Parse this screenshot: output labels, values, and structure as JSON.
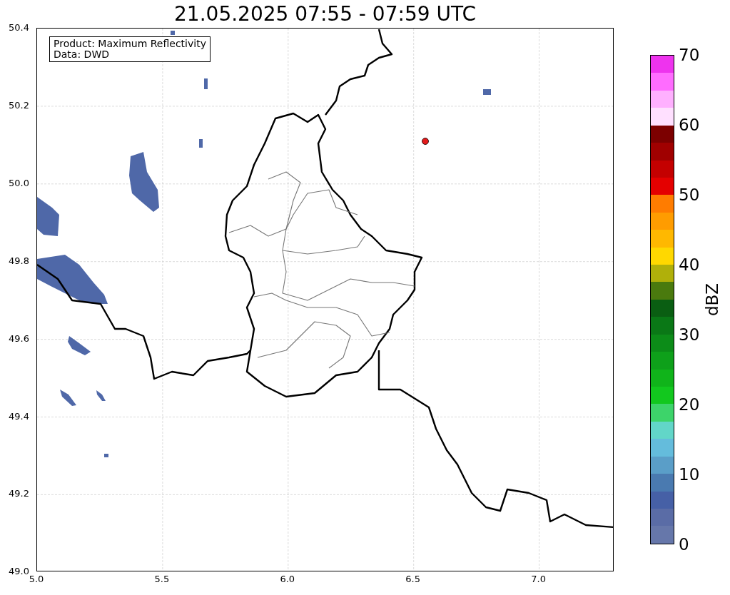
{
  "title": "21.05.2025 07:55 - 07:59 UTC",
  "legend": [
    "Product: Maximum Reflectivity",
    "Data: DWD"
  ],
  "x_ticks": [
    "5.0",
    "5.5",
    "6.0",
    "6.5",
    "7.0"
  ],
  "y_ticks": [
    "50.4",
    "50.2",
    "50.0",
    "49.8",
    "49.6",
    "49.4",
    "49.2",
    "49.0"
  ],
  "colorbar": {
    "label": "dBZ",
    "ticks": [
      "70",
      "60",
      "50",
      "40",
      "30",
      "20",
      "10",
      "0"
    ],
    "segments": [
      {
        "color": "#ee33ee"
      },
      {
        "color": "#ff6cff"
      },
      {
        "color": "#ffb0ff"
      },
      {
        "color": "#ffe0ff"
      },
      {
        "color": "#7c0000"
      },
      {
        "color": "#a00000"
      },
      {
        "color": "#c40000"
      },
      {
        "color": "#e40000"
      },
      {
        "color": "#ff7c00"
      },
      {
        "color": "#ff9c00"
      },
      {
        "color": "#ffb800"
      },
      {
        "color": "#ffd800"
      },
      {
        "color": "#b0b00a"
      },
      {
        "color": "#4a7a0e"
      },
      {
        "color": "#0a5e12"
      },
      {
        "color": "#0a7816"
      },
      {
        "color": "#0c8c18"
      },
      {
        "color": "#0ea01a"
      },
      {
        "color": "#10b41a"
      },
      {
        "color": "#12c81e"
      },
      {
        "color": "#3dd46a"
      },
      {
        "color": "#62d6c8"
      },
      {
        "color": "#64bcdc"
      },
      {
        "color": "#5a9ec8"
      },
      {
        "color": "#4a7ab0"
      },
      {
        "color": "#4660a6"
      },
      {
        "color": "#5a6ca6"
      },
      {
        "color": "#6677aa"
      }
    ]
  }
}
